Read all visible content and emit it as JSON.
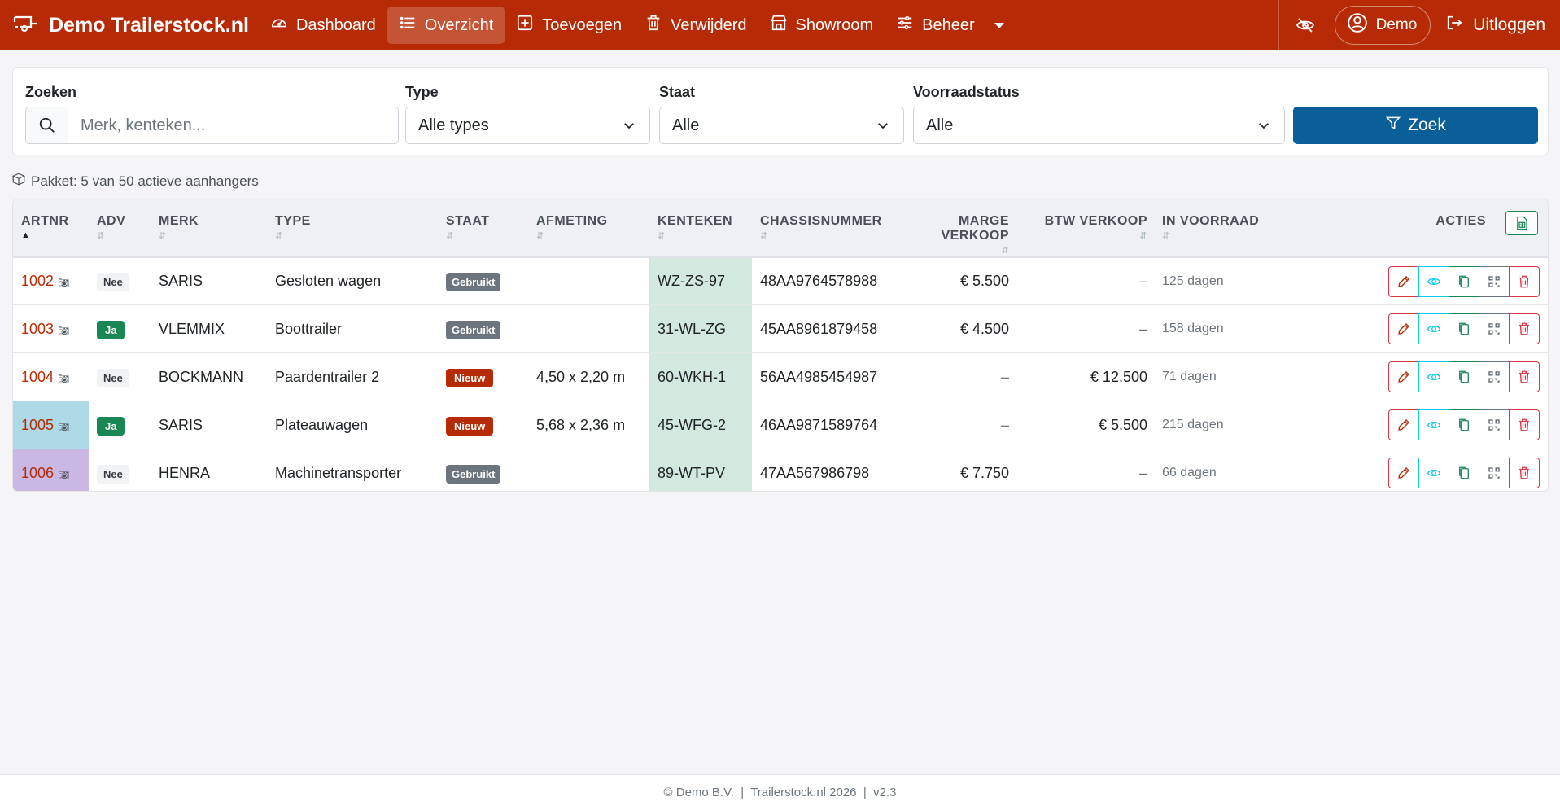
{
  "brand": {
    "name": "Demo Trailerstock.nl",
    "icon": "trailer-icon"
  },
  "nav": [
    {
      "label": "Dashboard",
      "icon": "speedometer-icon",
      "active": false
    },
    {
      "label": "Overzicht",
      "icon": "list-icon",
      "active": true
    },
    {
      "label": "Toevoegen",
      "icon": "plus-square-icon",
      "active": false
    },
    {
      "label": "Verwijderd",
      "icon": "trash-icon",
      "active": false
    },
    {
      "label": "Showroom",
      "icon": "shop-icon",
      "active": false
    },
    {
      "label": "Beheer",
      "icon": "sliders-icon",
      "active": false
    }
  ],
  "user": {
    "name": "Demo",
    "logout": "Uitloggen"
  },
  "filters": {
    "search": {
      "label": "Zoeken",
      "placeholder": "Merk, kenteken..."
    },
    "type": {
      "label": "Type",
      "value": "Alle types"
    },
    "staat": {
      "label": "Staat",
      "value": "Alle"
    },
    "voorraad": {
      "label": "Voorraadstatus",
      "value": "Alle"
    },
    "button": "Zoek"
  },
  "pakket": "Pakket: 5 van 50 actieve aanhangers",
  "table": {
    "headers": {
      "artnr": "ARTNR",
      "adv": "ADV",
      "merk": "MERK",
      "type": "TYPE",
      "staat": "STAAT",
      "afmeting": "AFMETING",
      "kenteken": "KENTEKEN",
      "chassis": "CHASSISNUMMER",
      "marge": "MARGE VERKOOP",
      "btw": "BTW VERKOOP",
      "voorraad": "IN VOORRAAD",
      "acties": "ACTIES"
    },
    "rows": [
      {
        "artnr": "1002",
        "adv": "Nee",
        "merk": "SARIS",
        "type": "Gesloten wagen",
        "staat": "Gebruikt",
        "afmeting": "",
        "kenteken": "WZ-ZS-97",
        "chassis": "48AA9764578988",
        "marge": "€ 5.500",
        "btw": "–",
        "voorraad": "125 dagen",
        "highlight": ""
      },
      {
        "artnr": "1003",
        "adv": "Ja",
        "merk": "VLEMMIX",
        "type": "Boottrailer",
        "staat": "Gebruikt",
        "afmeting": "",
        "kenteken": "31-WL-ZG",
        "chassis": "45AA8961879458",
        "marge": "€ 4.500",
        "btw": "–",
        "voorraad": "158 dagen",
        "highlight": ""
      },
      {
        "artnr": "1004",
        "adv": "Nee",
        "merk": "BOCKMANN",
        "type": "Paardentrailer 2",
        "staat": "Nieuw",
        "afmeting": "4,50 x 2,20 m",
        "kenteken": "60-WKH-1",
        "chassis": "56AA4985454987",
        "marge": "–",
        "btw": "€ 12.500",
        "voorraad": "71 dagen",
        "highlight": ""
      },
      {
        "artnr": "1005",
        "adv": "Ja",
        "merk": "SARIS",
        "type": "Plateauwagen",
        "staat": "Nieuw",
        "afmeting": "5,68 x 2,36 m",
        "kenteken": "45-WFG-2",
        "chassis": "46AA9871589764",
        "marge": "–",
        "btw": "€ 5.500",
        "voorraad": "215 dagen",
        "highlight": "#add8e6"
      },
      {
        "artnr": "1006",
        "adv": "Nee",
        "merk": "HENRA",
        "type": "Machinetransporter",
        "staat": "Gebruikt",
        "afmeting": "",
        "kenteken": "89-WT-PV",
        "chassis": "47AA567986798",
        "marge": "€ 7.750",
        "btw": "–",
        "voorraad": "66 dagen",
        "highlight": "#c9b8e4"
      }
    ]
  },
  "footer": "© Demo B.V.  |  Trailerstock.nl 2026  |  v2.3",
  "colors": {
    "navbar": "#b72a06",
    "primary": "#0b5f99",
    "kenteken_bg": "#d3e8df"
  }
}
